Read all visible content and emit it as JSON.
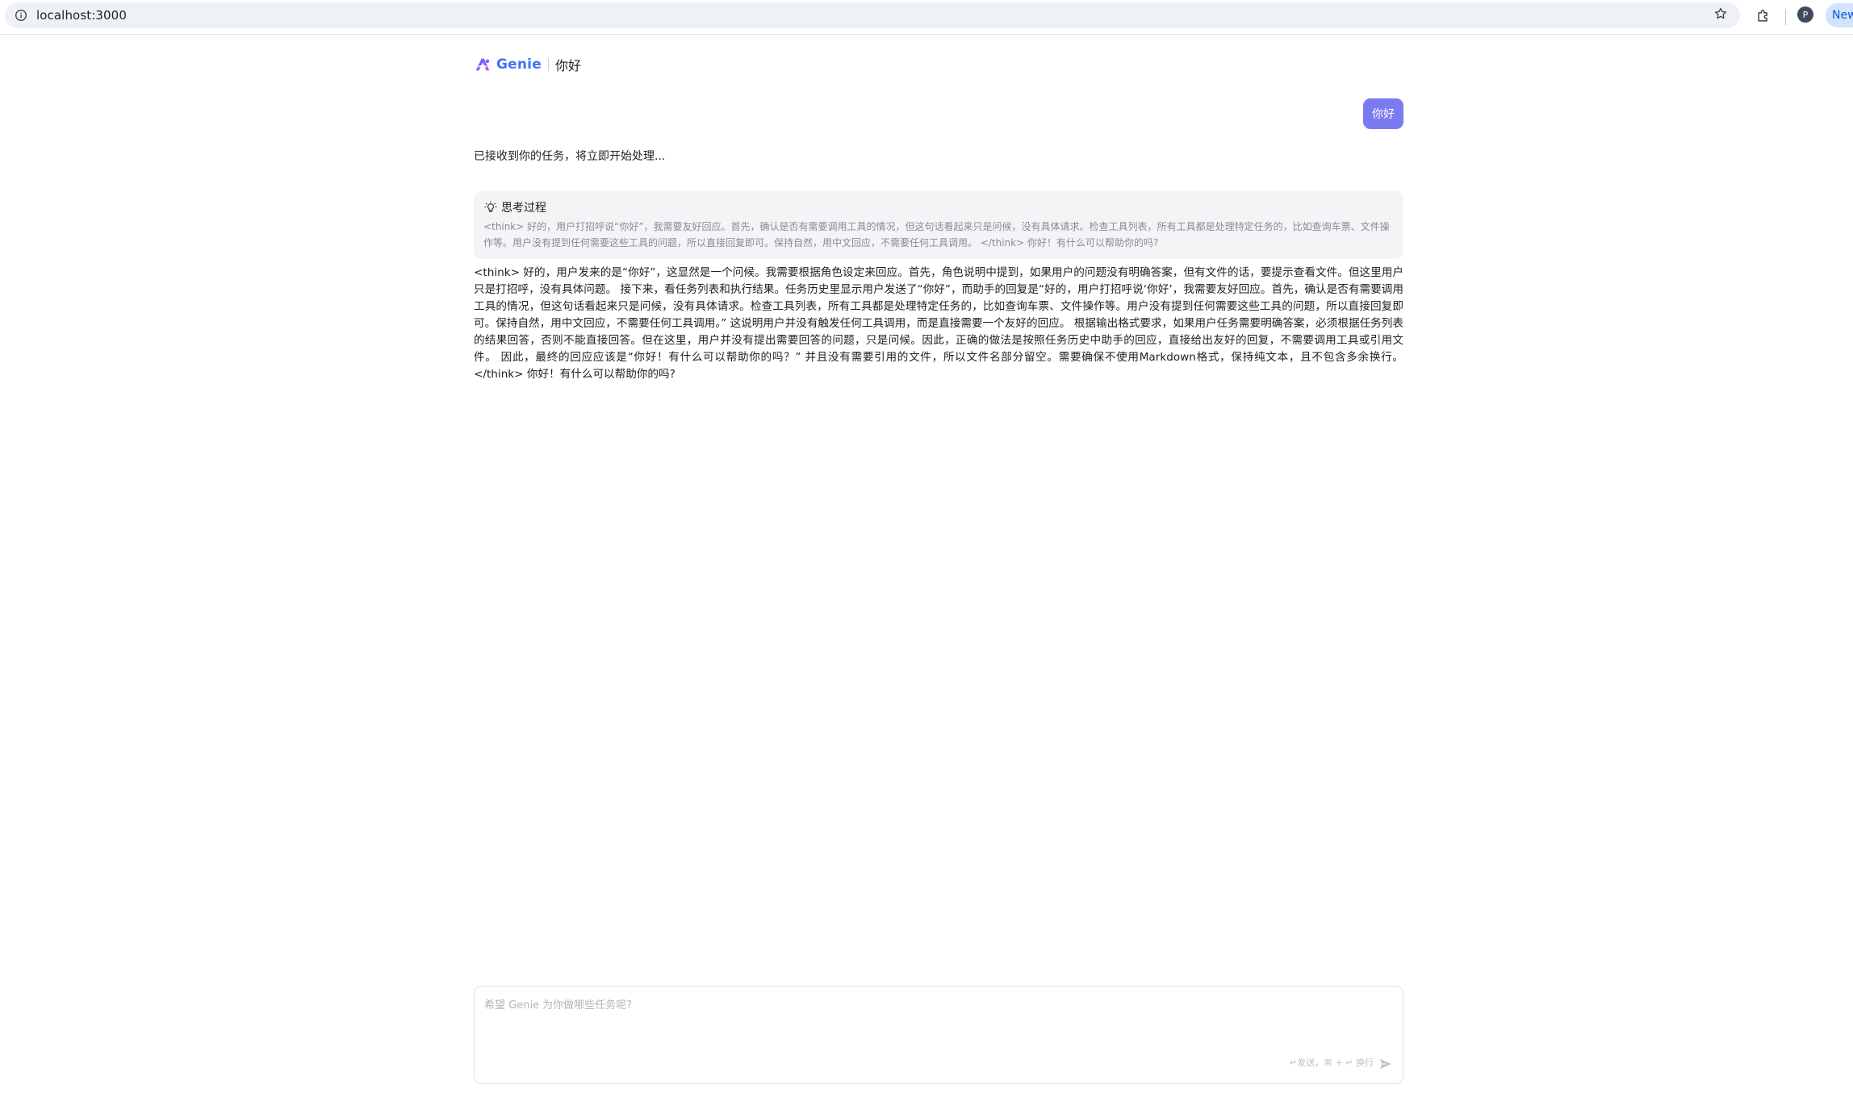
{
  "browser": {
    "url": "localhost:3000",
    "profile_initial": "P",
    "new_chip_label": "New"
  },
  "header": {
    "brand": "Genie",
    "chat_title": "你好"
  },
  "conversation": {
    "user_message": "你好",
    "ack_message": "已接收到你的任务，将立即开始处理...",
    "thinking": {
      "title": "思考过程",
      "text": "<think> 好的，用户打招呼说“你好”，我需要友好回应。首先，确认是否有需要调用工具的情况，但这句话看起来只是问候，没有具体请求。检查工具列表，所有工具都是处理特定任务的，比如查询车票、文件操作等。用户没有提到任何需要这些工具的问题，所以直接回复即可。保持自然，用中文回应，不需要任何工具调用。 </think> 你好！有什么可以帮助你的吗?"
    },
    "answer": "<think> 好的，用户发来的是“你好”，这显然是一个问候。我需要根据角色设定来回应。首先，角色说明中提到，如果用户的问题没有明确答案，但有文件的话，要提示查看文件。但这里用户只是打招呼，没有具体问题。 接下来，看任务列表和执行结果。任务历史里显示用户发送了“你好”，而助手的回复是“好的，用户打招呼说‘你好’，我需要友好回应。首先，确认是否有需要调用工具的情况，但这句话看起来只是问候，没有具体请求。检查工具列表，所有工具都是处理特定任务的，比如查询车票、文件操作等。用户没有提到任何需要这些工具的问题，所以直接回复即可。保持自然，用中文回应，不需要任何工具调用。” 这说明用户并没有触发任何工具调用，而是直接需要一个友好的回应。 根据输出格式要求，如果用户任务需要明确答案，必须根据任务列表的结果回答，否则不能直接回答。但在这里，用户并没有提出需要回答的问题，只是问候。因此，正确的做法是按照任务历史中助手的回应，直接给出友好的回复，不需要调用工具或引用文件。 因此，最终的回应应该是“你好！有什么可以帮助你的吗？” 并且没有需要引用的文件，所以文件名部分留空。需要确保不使用Markdown格式，保持纯文本，且不包含多余换行。 </think> 你好！有什么可以帮助你的吗?"
  },
  "composer": {
    "placeholder": "希望 Genie 为你做哪些任务呢?",
    "hint": "↵发送，⌘ + ↵ 换行"
  },
  "icons": {
    "site_info": "info-icon",
    "bookmark": "star-icon",
    "extensions": "puzzle-icon",
    "logo": "genie-logo-icon",
    "thinking": "lightbulb-icon",
    "send": "send-icon"
  },
  "colors": {
    "brand": "#3e74f6",
    "user_bubble": "#7b7bf1",
    "thinking_bg": "#f3f4f6"
  }
}
